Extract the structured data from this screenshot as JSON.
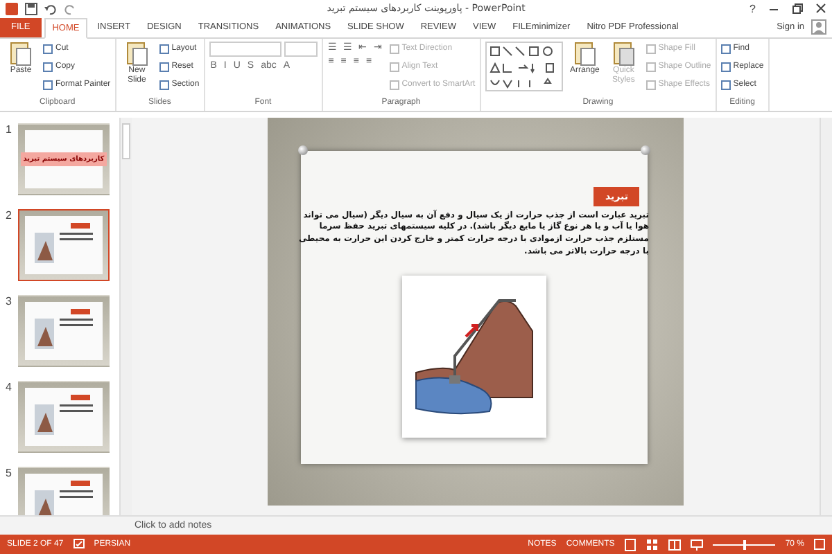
{
  "window": {
    "title": "پاورپوینت کاربردهای سیستم تبرید - PowerPoint",
    "help": "?"
  },
  "tabs": [
    {
      "label": "FILE",
      "kind": "file",
      "selected": false
    },
    {
      "label": "HOME",
      "kind": "tab",
      "selected": true
    },
    {
      "label": "INSERT",
      "kind": "tab",
      "selected": false
    },
    {
      "label": "DESIGN",
      "kind": "tab",
      "selected": false
    },
    {
      "label": "TRANSITIONS",
      "kind": "tab",
      "selected": false
    },
    {
      "label": "ANIMATIONS",
      "kind": "tab",
      "selected": false
    },
    {
      "label": "SLIDE SHOW",
      "kind": "tab",
      "selected": false
    },
    {
      "label": "REVIEW",
      "kind": "tab",
      "selected": false
    },
    {
      "label": "VIEW",
      "kind": "tab",
      "selected": false
    },
    {
      "label": "FILEminimizer",
      "kind": "tab",
      "selected": false
    },
    {
      "label": "Nitro PDF Professional",
      "kind": "tab",
      "selected": false
    }
  ],
  "sign_in": "Sign in",
  "ribbon": [
    {
      "name": "Clipboard",
      "columns": [
        [
          {
            "kind": "large",
            "label": "Paste",
            "disabled": false
          }
        ],
        [
          {
            "kind": "small",
            "label": "Cut",
            "disabled": false
          },
          {
            "kind": "small",
            "label": "Copy",
            "disabled": false
          },
          {
            "kind": "small",
            "label": "Format Painter",
            "disabled": false
          }
        ]
      ]
    },
    {
      "name": "Slides",
      "columns": [
        [
          {
            "kind": "large",
            "label": "New Slide",
            "disabled": false
          }
        ],
        [
          {
            "kind": "small",
            "label": "Layout",
            "disabled": false
          },
          {
            "kind": "small",
            "label": "Reset",
            "disabled": false
          },
          {
            "kind": "small",
            "label": "Section",
            "disabled": false
          }
        ]
      ]
    },
    {
      "name": "Font",
      "columns": [
        [
          {
            "kind": "fields"
          },
          {
            "kind": "glyphs",
            "labels": [
              "B",
              "I",
              "U",
              "S",
              "abc",
              "A"
            ]
          }
        ]
      ]
    },
    {
      "name": "Paragraph",
      "columns": [
        [
          {
            "kind": "glyphs",
            "labels": [
              "☰",
              "☰",
              "⇤",
              "⇥"
            ]
          },
          {
            "kind": "glyphs",
            "labels": [
              "≡",
              "≡",
              "≡",
              "≡"
            ]
          }
        ],
        [
          {
            "kind": "small",
            "label": "Text Direction",
            "disabled": true
          },
          {
            "kind": "small",
            "label": "Align Text",
            "disabled": true
          },
          {
            "kind": "small",
            "label": "Convert to SmartArt",
            "disabled": true
          }
        ]
      ]
    },
    {
      "name": "Drawing",
      "columns": [
        [
          {
            "kind": "shapes"
          }
        ],
        [
          {
            "kind": "large",
            "label": "Arrange",
            "disabled": false
          }
        ],
        [
          {
            "kind": "large",
            "label": "Quick Styles",
            "disabled": true
          }
        ],
        [
          {
            "kind": "small",
            "label": "Shape Fill",
            "disabled": true
          },
          {
            "kind": "small",
            "label": "Shape Outline",
            "disabled": true
          },
          {
            "kind": "small",
            "label": "Shape Effects",
            "disabled": true
          }
        ]
      ]
    },
    {
      "name": "Editing",
      "columns": [
        [
          {
            "kind": "small",
            "label": "Find",
            "disabled": false
          },
          {
            "kind": "small",
            "label": "Replace",
            "disabled": false
          },
          {
            "kind": "small",
            "label": "Select",
            "disabled": false
          }
        ]
      ]
    }
  ],
  "thumbnails": [
    {
      "number": "1",
      "selected": false,
      "title": "کاربردهای سیستم تبرید"
    },
    {
      "number": "2",
      "selected": true
    },
    {
      "number": "3",
      "selected": false
    },
    {
      "number": "4",
      "selected": false
    },
    {
      "number": "5",
      "selected": false
    }
  ],
  "slide": {
    "title": "تبرید",
    "body": "تبرید عبارت است از جذب حرارت از یک سیال و دفع آن به سیال دیگر (سیال می تواند هوا یا آب و یا هر نوع گاز یا مایع دیگر باشد). در کلیه سیستمهای تبرید حفظ سرما مستلزم جذب حرارت ازموادی با درجه حرارت کمتر و خارج کردن این حرارت به محیطی با درجه حرارت بالاتر می باشد."
  },
  "notes": {
    "placeholder": "Click to add notes"
  },
  "status_bar": {
    "slide": "SLIDE 2 OF 47",
    "language": "PERSIAN",
    "notes": "NOTES",
    "comments": "COMMENTS",
    "zoom": "70 %",
    "level": 0.5
  }
}
